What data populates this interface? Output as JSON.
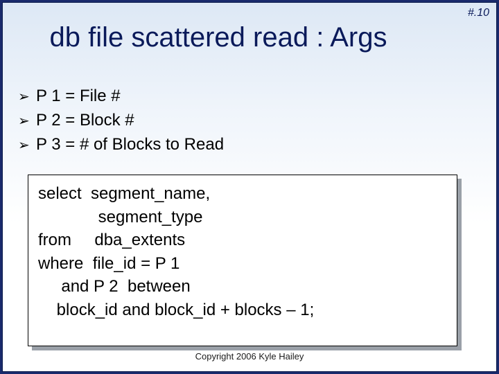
{
  "page_number": "#.10",
  "title": "db file scattered read : Args",
  "bullets": [
    "P 1 = File #",
    "P 2 = Block #",
    "P 3 = # of Blocks to Read"
  ],
  "code": {
    "l1": "select  segment_name,",
    "l2": "             segment_type",
    "l3": "from     dba_extents",
    "l4": "where  file_id = P 1",
    "l5": "     and P 2  between",
    "l6": "    block_id and block_id + blocks – 1;"
  },
  "copyright": "Copyright 2006 Kyle Hailey"
}
